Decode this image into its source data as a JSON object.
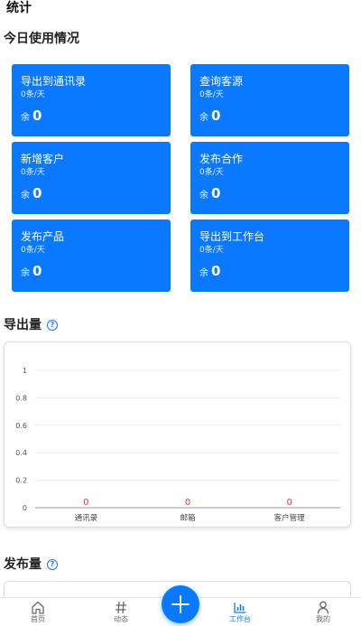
{
  "page": {
    "title": "统计"
  },
  "today": {
    "title": "今日使用情况",
    "remain_label": "余",
    "cards": [
      {
        "name": "导出到通讯录",
        "limit": "0条/天",
        "remain": "0"
      },
      {
        "name": "查询客源",
        "limit": "0条/天",
        "remain": "0"
      },
      {
        "name": "新增客户",
        "limit": "0条/天",
        "remain": "0"
      },
      {
        "name": "发布合作",
        "limit": "0条/天",
        "remain": "0"
      },
      {
        "name": "发布产品",
        "limit": "0条/天",
        "remain": "0"
      },
      {
        "name": "导出到工作台",
        "limit": "0条/天",
        "remain": "0"
      }
    ]
  },
  "export_section": {
    "title": "导出量",
    "help_icon": "question-circle-icon"
  },
  "publish_section": {
    "title": "发布量",
    "help_icon": "question-circle-icon"
  },
  "chart_data": {
    "type": "bar",
    "categories": [
      "通讯录",
      "邮箱",
      "客户管理"
    ],
    "values": [
      0,
      0,
      0
    ],
    "data_labels": [
      "0",
      "0",
      "0"
    ],
    "yticks": [
      "0",
      "0.2",
      "0.4",
      "0.6",
      "0.8",
      "1"
    ],
    "ylim": [
      0,
      1
    ],
    "grid": true,
    "label_color": "#e53935"
  },
  "tabbar": {
    "items": [
      {
        "label": "首页",
        "icon": "home-icon"
      },
      {
        "label": "动态",
        "icon": "hash-icon"
      },
      {
        "label": "工作台",
        "icon": "bar-chart-icon",
        "active": true
      },
      {
        "label": "我的",
        "icon": "user-icon"
      }
    ],
    "fab_icon": "plus-icon",
    "active_color": "#1677ff"
  },
  "colors": {
    "card_bg": "#0a78ff",
    "accent": "#1677ff"
  }
}
